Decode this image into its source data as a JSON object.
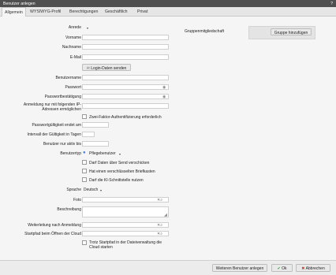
{
  "window": {
    "title": "Benutzer anlegen",
    "help": "?"
  },
  "tabs": [
    {
      "label": "Allgemein"
    },
    {
      "label": "WYSIWYG-Profil"
    },
    {
      "label": "Berechtigungen"
    },
    {
      "label": "Geschäftlich"
    },
    {
      "label": "Privat"
    }
  ],
  "form": {
    "anrede_label": "Anrede",
    "anrede_value": "",
    "vorname_label": "Vorname",
    "nachname_label": "Nachname",
    "email_label": "E-Mail",
    "login_button": "Login-Daten senden",
    "benutzername_label": "Benutzername",
    "passwort_label": "Passwort",
    "passwort_confirm_label": "Passwortbestätigung",
    "ip_label": "Anmeldung nur mit folgenden IP-Adressen ermöglichen",
    "twofa_label": "Zwei-Faktor-Authentifizierung erforderlich",
    "gueltig_label": "Passwortgültigkeit endet am",
    "intervall_label": "Intervall der Gültigkeit in Tagen",
    "aktiv_label": "Benutzer nur aktiv bis",
    "benutzertyp_label": "Benutzertyp",
    "benutzertyp_value": "Pflegebenutzer",
    "check1": "Darf Daten über Send verschicken",
    "check2": "Hat einen verschlüsselten Briefkasten",
    "check3": "Darf die KI-Schnittstelle nutzen",
    "sprache_label": "Sprache",
    "sprache_value": "Deutsch",
    "foto_label": "Foto",
    "beschreibung_label": "Beschreibung",
    "weiterleitung_label": "Weiterleitung nach Anmeldung",
    "startpfad_label": "Startpfad beim Öffnen der Cloud",
    "trotz_label": "Trotz Startpfad in der Dateiverwaltung die Cloud starten"
  },
  "groups": {
    "label": "Gruppenmitgliedschaft",
    "button": "Gruppe hinzufügen"
  },
  "footer": {
    "weiteren": "Weiteren Benutzer anlegen",
    "ok": "Ok",
    "abbrechen": "Abbrechen"
  },
  "colors": {
    "titlebar": "#4f4f4f",
    "ok_check": "#3a9a3a",
    "cancel_x": "#c0392b"
  }
}
